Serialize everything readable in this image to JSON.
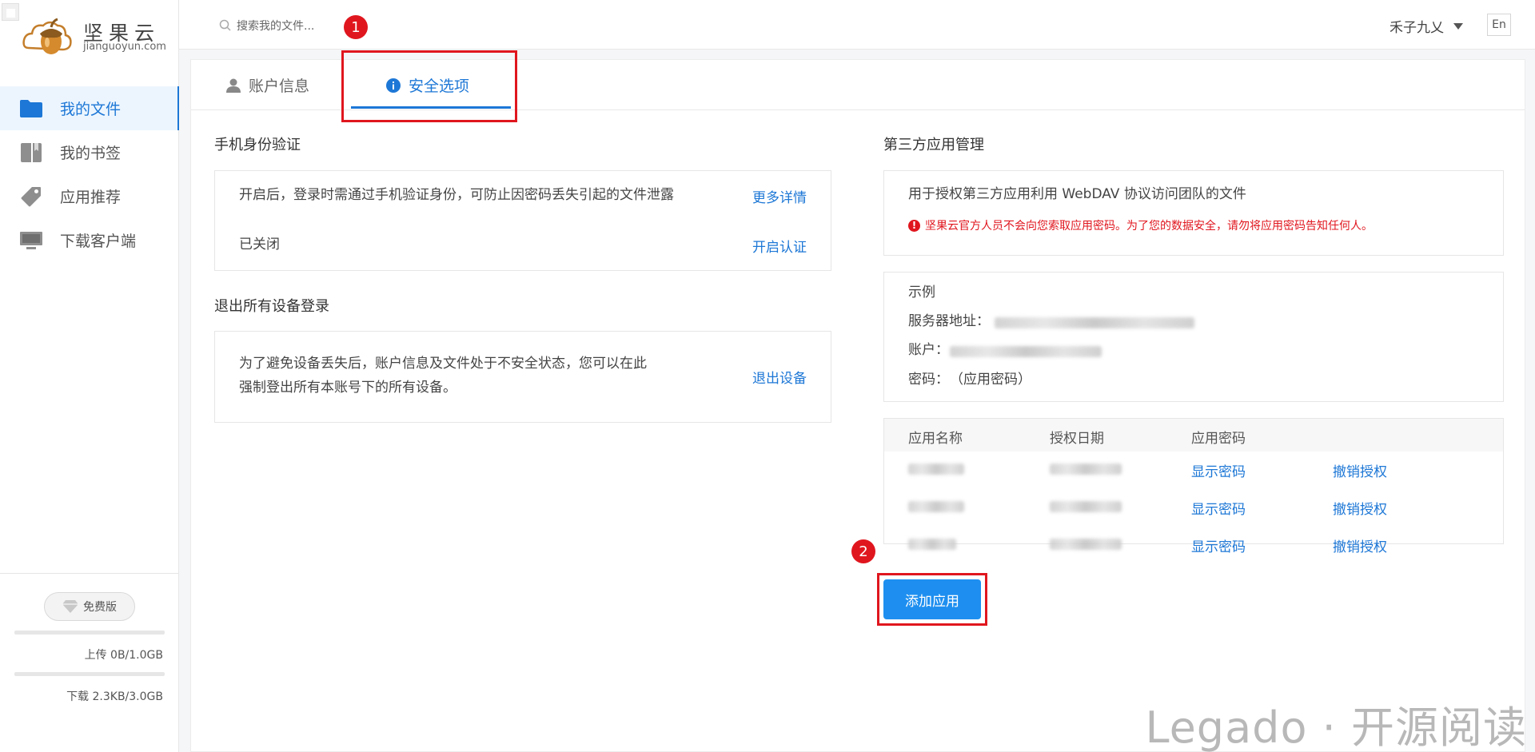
{
  "logo": {
    "name": "坚果云",
    "domain": "jianguoyun.com"
  },
  "sidebar": {
    "items": [
      {
        "label": "我的文件",
        "icon": "folder-icon",
        "active": true
      },
      {
        "label": "我的书签",
        "icon": "bookmark-icon",
        "active": false
      },
      {
        "label": "应用推荐",
        "icon": "tag-icon",
        "active": false
      },
      {
        "label": "下载客户端",
        "icon": "monitor-icon",
        "active": false
      }
    ],
    "plan_label": "免费版",
    "upload_quota": "上传 0B/1.0GB",
    "download_quota": "下载 2.3KB/3.0GB"
  },
  "header": {
    "search_placeholder": "搜索我的文件...",
    "username": "禾子九乂",
    "lang_button": "En"
  },
  "annotations": {
    "badge1": "1",
    "badge2": "2"
  },
  "tabs": [
    {
      "label": "账户信息",
      "icon": "user-icon",
      "active": false
    },
    {
      "label": "安全选项",
      "icon": "info-icon",
      "active": true
    }
  ],
  "phone_auth": {
    "title": "手机身份验证",
    "description": "开启后，登录时需通过手机验证身份，可防止因密码丢失引起的文件泄露",
    "more_link": "更多详情",
    "status": "已关闭",
    "enable_link": "开启认证"
  },
  "logout_all": {
    "title": "退出所有设备登录",
    "description_line1": "为了避免设备丢失后，账户信息及文件处于不安全状态，您可以在此",
    "description_line2": "强制登出所有本账号下的所有设备。",
    "action_link": "退出设备"
  },
  "third_party": {
    "title": "第三方应用管理",
    "description": "用于授权第三方应用利用 WebDAV 协议访问团队的文件",
    "warning": "坚果云官方人员不会向您索取应用密码。为了您的数据安全，请勿将应用密码告知任何人。",
    "example_title": "示例",
    "server_label": "服务器地址：",
    "account_label": "账户：",
    "password_label": "密码：",
    "password_value": "（应用密码）",
    "table": {
      "headers": [
        "应用名称",
        "授权日期",
        "应用密码"
      ],
      "rows": [
        {
          "show_password": "显示密码",
          "revoke": "撤销授权"
        },
        {
          "show_password": "显示密码",
          "revoke": "撤销授权"
        },
        {
          "show_password": "显示密码",
          "revoke": "撤销授权"
        }
      ]
    },
    "add_button": "添加应用"
  },
  "watermark": "Legado · 开源阅读"
}
